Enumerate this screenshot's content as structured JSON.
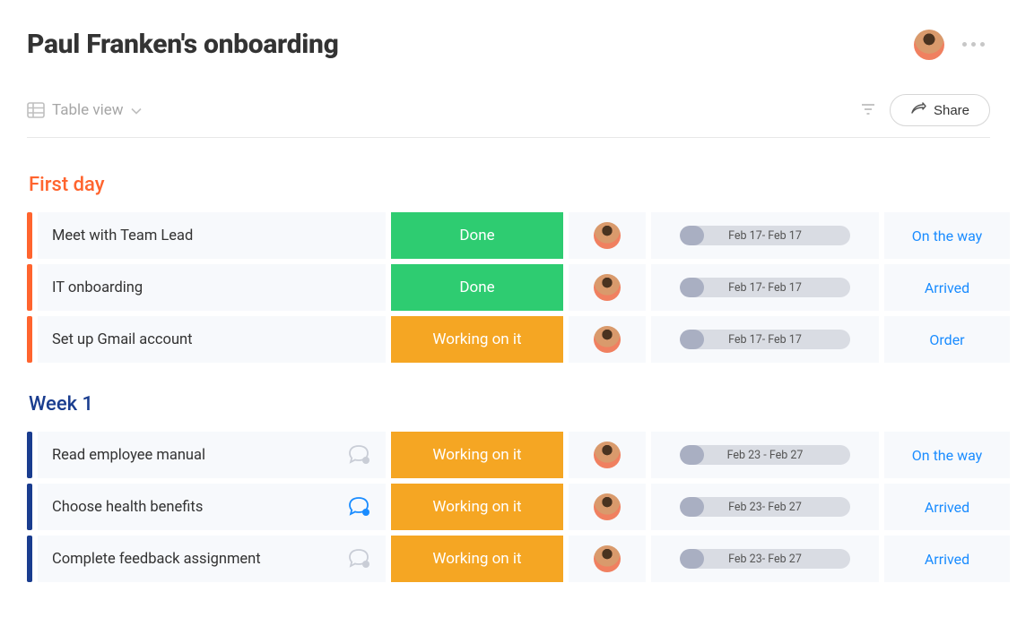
{
  "header": {
    "title": "Paul Franken's onboarding"
  },
  "toolbar": {
    "view_label": "Table view",
    "share_label": "Share"
  },
  "groups": [
    {
      "id": "first-day",
      "title": "First day",
      "color": "orange",
      "rows": [
        {
          "name": "Meet with Team Lead",
          "status": "Done",
          "status_kind": "done",
          "timeline": "Feb 17- Feb 17",
          "fill_pct": 14,
          "tag": "On the way",
          "chat": "none"
        },
        {
          "name": "IT onboarding",
          "status": "Done",
          "status_kind": "done",
          "timeline": "Feb 17- Feb 17",
          "fill_pct": 14,
          "tag": "Arrived",
          "chat": "none"
        },
        {
          "name": "Set up Gmail account",
          "status": "Working on it",
          "status_kind": "working",
          "timeline": "Feb 17- Feb 17",
          "fill_pct": 14,
          "tag": "Order",
          "chat": "none"
        }
      ]
    },
    {
      "id": "week-1",
      "title": "Week 1",
      "color": "blue",
      "rows": [
        {
          "name": "Read employee manual",
          "status": "Working on it",
          "status_kind": "working",
          "timeline": "Feb 23 - Feb 27",
          "fill_pct": 14,
          "tag": "On the way",
          "chat": "empty"
        },
        {
          "name": "Choose health benefits",
          "status": "Working on it",
          "status_kind": "working",
          "timeline": "Feb 23- Feb 27",
          "fill_pct": 14,
          "tag": "Arrived",
          "chat": "unread"
        },
        {
          "name": "Complete feedback assignment",
          "status": "Working on it",
          "status_kind": "working",
          "timeline": "Feb 23- Feb 27",
          "fill_pct": 14,
          "tag": "Arrived",
          "chat": "empty"
        }
      ]
    }
  ]
}
